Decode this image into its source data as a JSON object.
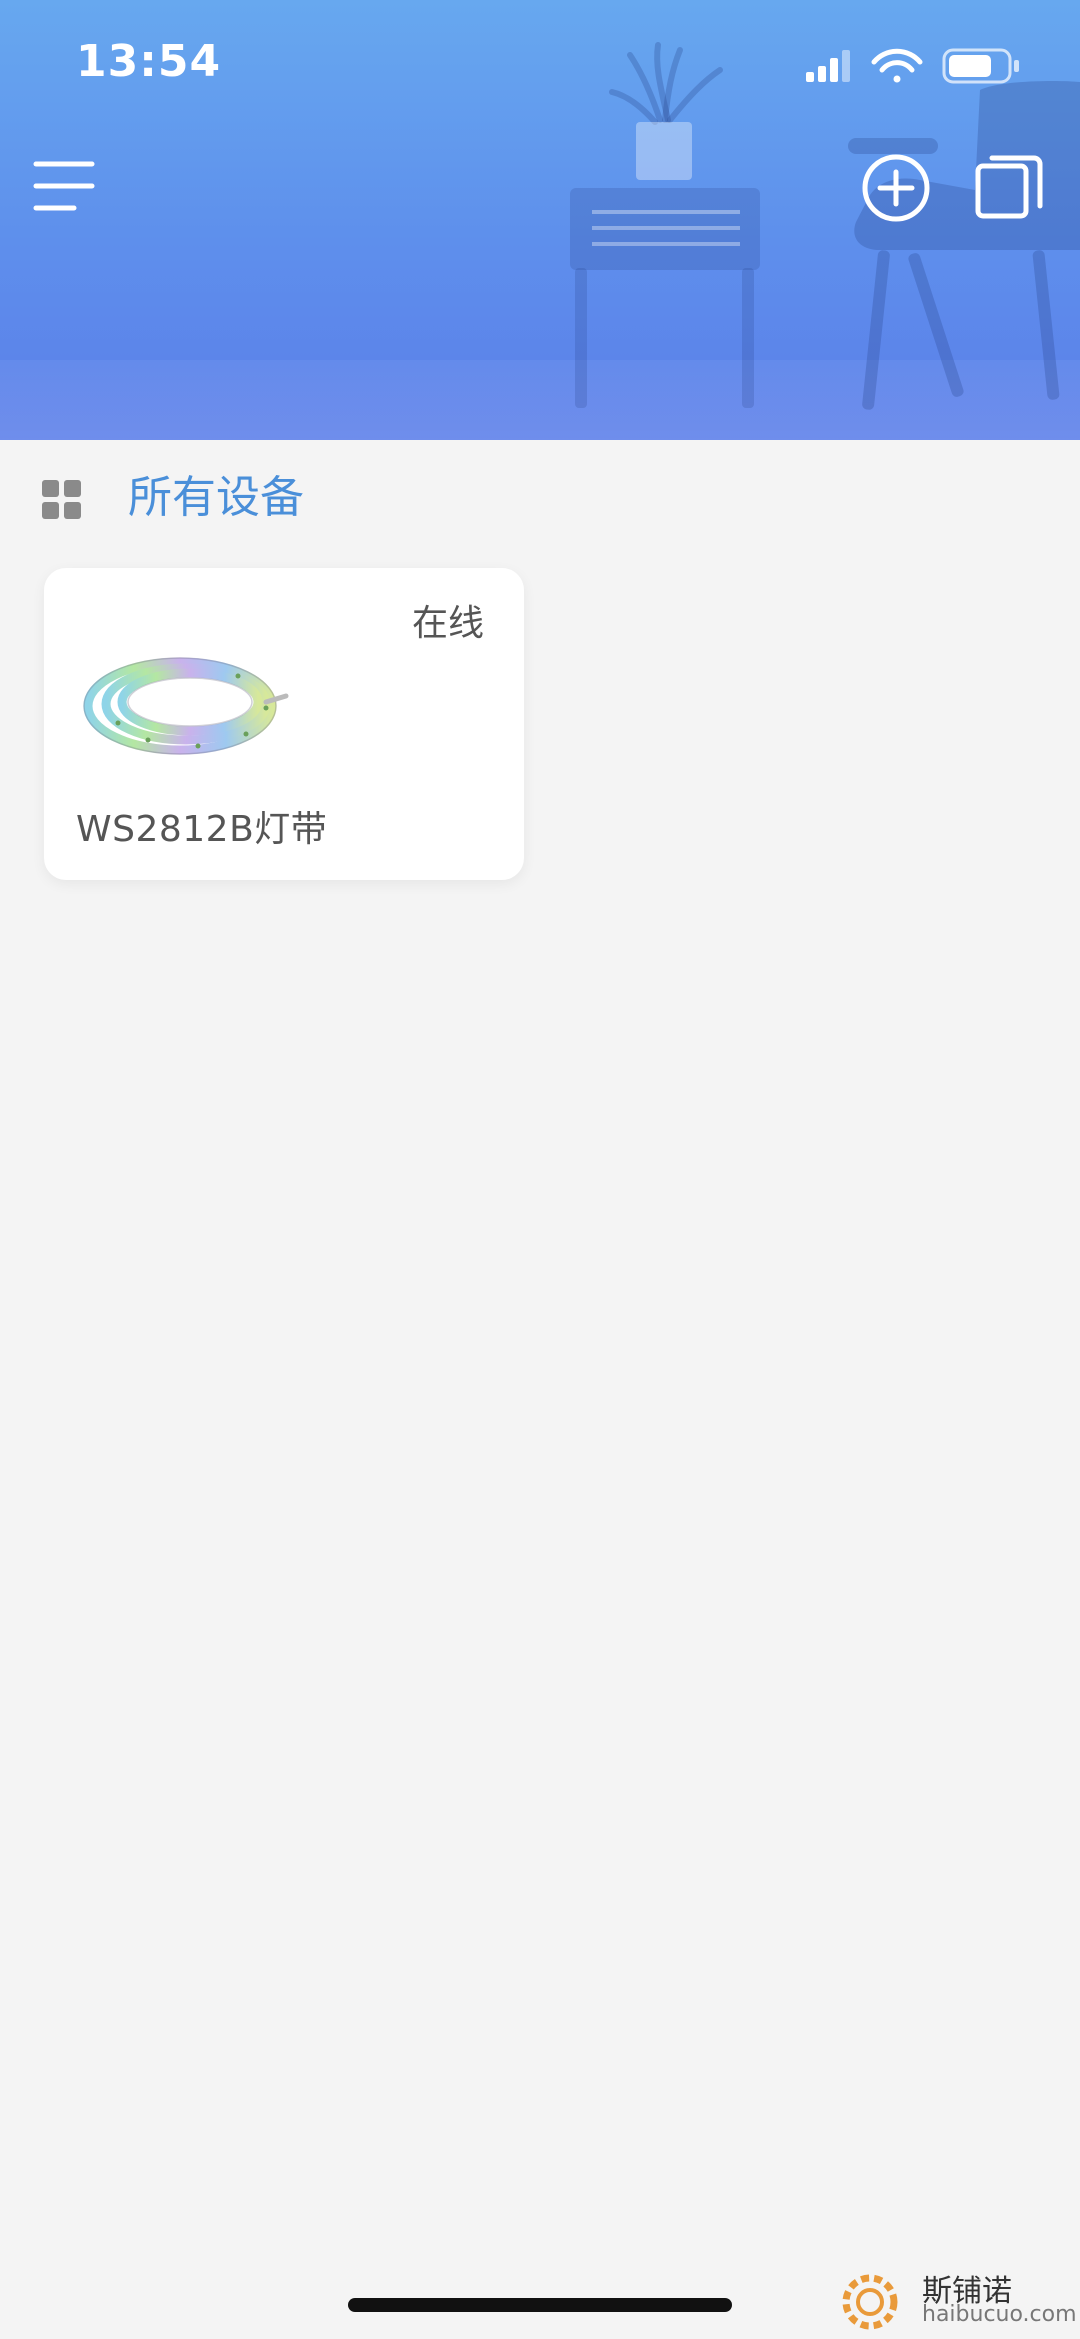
{
  "status_bar": {
    "time": "13:54"
  },
  "header": {
    "menu_icon": "hamburger-menu-icon",
    "add_icon": "plus-circle-icon",
    "scene_icon": "stacked-squares-icon",
    "gradient_top": "#67a8ef",
    "gradient_bottom": "#5b7ee9"
  },
  "section": {
    "icon": "grid-icon",
    "title": "所有设备",
    "title_color": "#4a8fd9"
  },
  "devices": [
    {
      "name": "WS2812B灯带",
      "status": "在线",
      "image_icon": "led-strip-icon"
    }
  ],
  "watermark": {
    "text": "斯铺诺",
    "sub": "haibucuo.com"
  }
}
